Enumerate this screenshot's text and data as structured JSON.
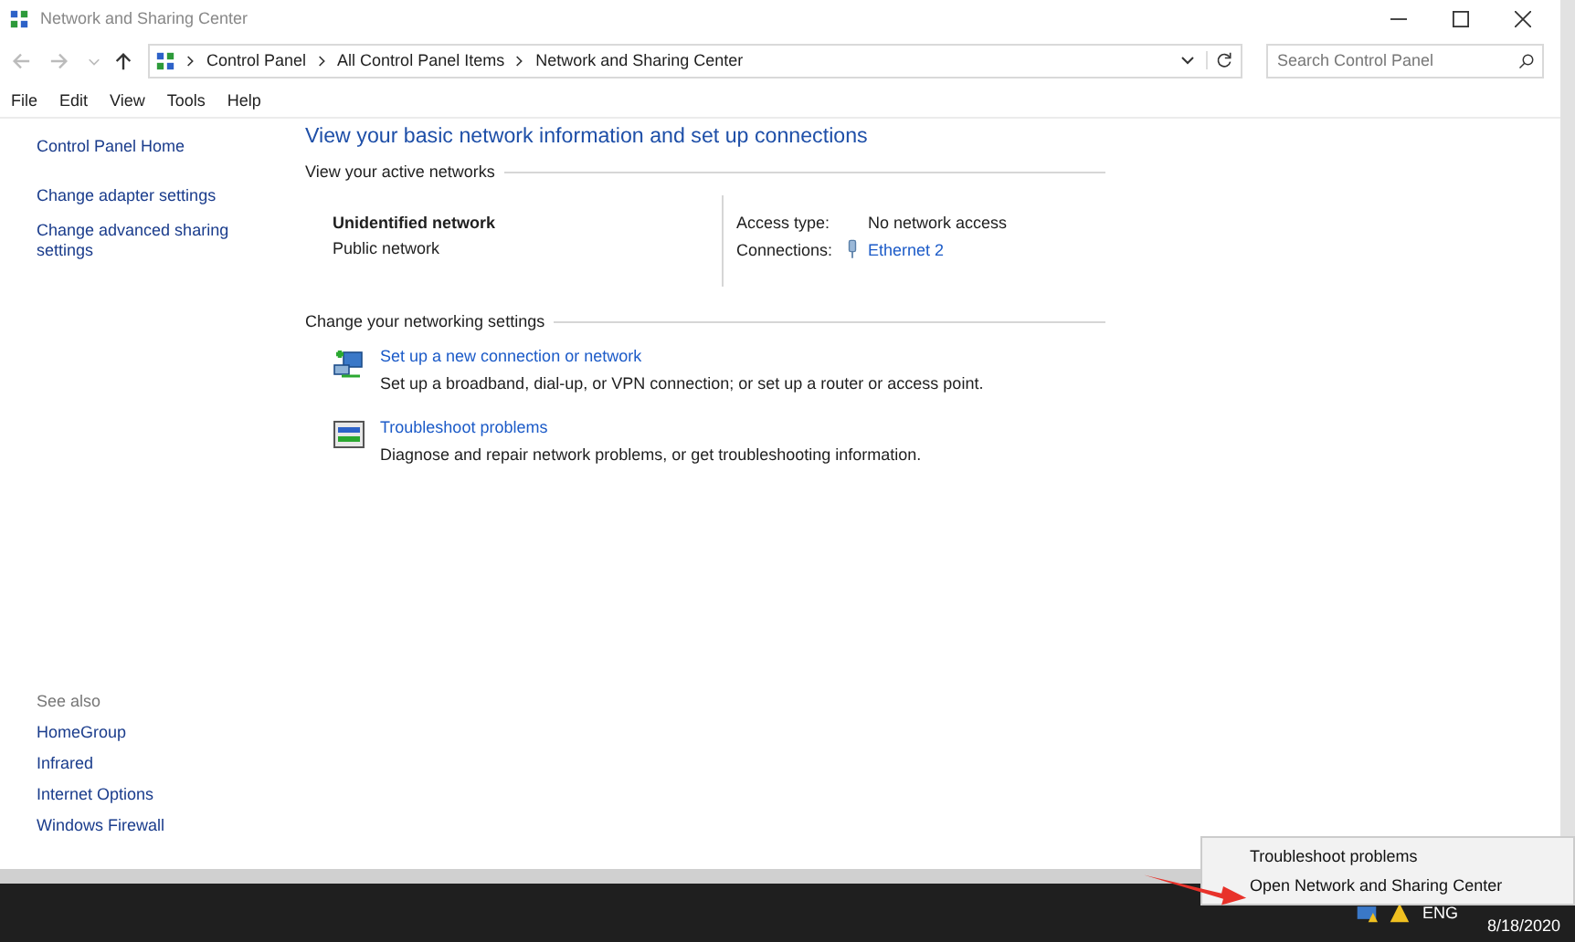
{
  "window": {
    "title": "Network and Sharing Center"
  },
  "breadcrumbs": [
    "Control Panel",
    "All Control Panel Items",
    "Network and Sharing Center"
  ],
  "search": {
    "placeholder": "Search Control Panel"
  },
  "menu": [
    "File",
    "Edit",
    "View",
    "Tools",
    "Help"
  ],
  "sidebar": {
    "links": [
      "Control Panel Home",
      "Change adapter settings",
      "Change advanced sharing settings"
    ],
    "see_also_title": "See also",
    "see_also": [
      "HomeGroup",
      "Infrared",
      "Internet Options",
      "Windows Firewall"
    ]
  },
  "main": {
    "heading": "View your basic network information and set up connections",
    "active_section": "View your active networks",
    "network": {
      "name": "Unidentified network",
      "category": "Public network",
      "access_label": "Access type:",
      "access_value": "No network access",
      "connections_label": "Connections:",
      "connection": "Ethernet 2"
    },
    "settings_section": "Change your networking settings",
    "tasks": [
      {
        "kind": "setup",
        "title": "Set up a new connection or network",
        "description": "Set up a broadband, dial-up, or VPN connection; or set up a router or access point."
      },
      {
        "kind": "troubleshoot",
        "title": "Troubleshoot problems",
        "description": "Diagnose and repair network problems, or get troubleshooting information."
      }
    ]
  },
  "context_menu": [
    "Troubleshoot problems",
    "Open Network and Sharing Center"
  ],
  "taskbar": {
    "language": "ENG",
    "date": "8/18/2020"
  }
}
